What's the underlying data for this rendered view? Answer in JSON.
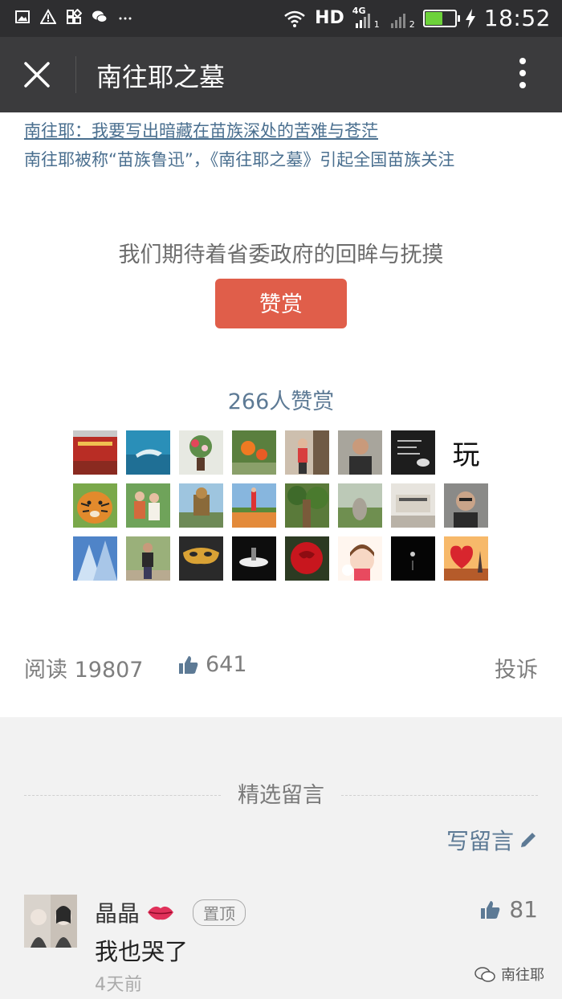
{
  "status_bar": {
    "network_label": "HD",
    "network_type": "4G",
    "sim_slot_1": "1",
    "sim_slot_2": "2",
    "time": "18:52",
    "battery_level": 0.55,
    "left_icons": [
      "image-icon",
      "warning-icon",
      "apps-icon",
      "wechat-icon",
      "more-dots-icon"
    ]
  },
  "header": {
    "title": "南往耶之墓"
  },
  "related_links": [
    "南往耶：我要写出暗藏在苗族深处的苦难与苍茫",
    "南往耶被称“苗族鲁迅”，《南往耶之墓》引起全国苗族关注"
  ],
  "reward": {
    "prompt": "我们期待着省委政府的回眸与抚摸",
    "button_label": "赞赏",
    "count_text": "266人赞赏",
    "last_avatar_char": "玩"
  },
  "stats": {
    "read_label": "阅读",
    "read_count": "19807",
    "like_count": "641",
    "report_label": "投诉"
  },
  "comments": {
    "section_title": "精选留言",
    "write_label": "写留言",
    "items": [
      {
        "author": "晶晶",
        "pinned_label": "置顶",
        "text": "我也哭了",
        "time": "4天前",
        "likes": "81"
      }
    ]
  },
  "watermark": "南往耶",
  "colors": {
    "status_bar": "#2e2e30",
    "nav_bar": "#3b3b3d",
    "link": "#4a6f8f",
    "reward_button": "#e05e4a",
    "accent_blue": "#5d7a95"
  }
}
